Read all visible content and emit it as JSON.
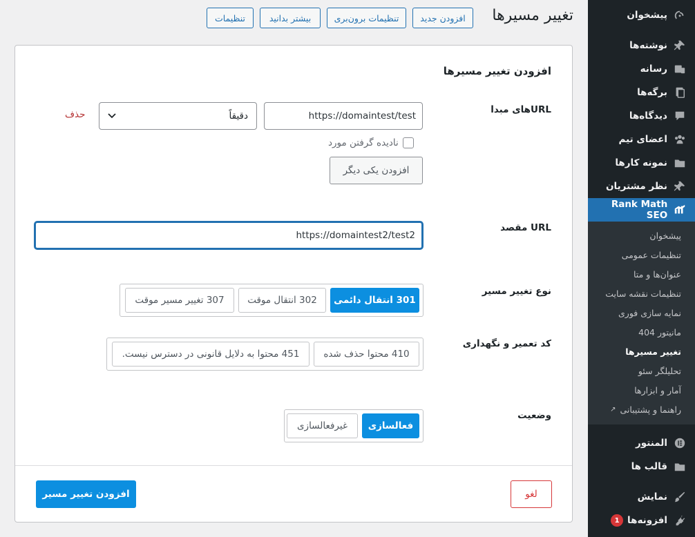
{
  "sidebar": {
    "items_top": [
      {
        "label": "پیشخوان",
        "icon": "dashboard-icon"
      },
      {
        "label": "نوشته‌ها",
        "icon": "pin-icon"
      },
      {
        "label": "رسانه",
        "icon": "media-icon"
      },
      {
        "label": "برگه‌ها",
        "icon": "pages-icon"
      },
      {
        "label": "دیدگاه‌ها",
        "icon": "comments-icon"
      },
      {
        "label": "اعضای تیم",
        "icon": "team-icon"
      },
      {
        "label": "نمونه کارها",
        "icon": "folder-icon"
      },
      {
        "label": "نظر مشتریان",
        "icon": "pin-icon"
      }
    ],
    "current": {
      "label": "Rank Math SEO",
      "icon": "rank-math-icon"
    },
    "submenu": [
      {
        "label": "پیشخوان"
      },
      {
        "label": "تنظیمات عمومی"
      },
      {
        "label": "عنوان‌ها و متا"
      },
      {
        "label": "تنظیمات نقشه سایت"
      },
      {
        "label": "نمایه سازی فوری"
      },
      {
        "label": "مانیتور 404"
      },
      {
        "label": "تغییر مسیرها"
      },
      {
        "label": "تحلیلگر سئو"
      },
      {
        "label": "آمار و ابزارها"
      },
      {
        "label": "راهنما و پشتیبانی"
      }
    ],
    "items_bottom": [
      {
        "label": "المنتور",
        "icon": "elementor-icon"
      },
      {
        "label": "قالب ها",
        "icon": "folder-icon"
      },
      {
        "label": "نمایش",
        "icon": "brush-icon"
      },
      {
        "label": "افزونه‌ها",
        "icon": "plugin-icon",
        "badge": "1"
      }
    ]
  },
  "header": {
    "title": "تغییر مسیرها",
    "buttons": {
      "add_new": "افزودن جدید",
      "import_export": "تنظیمات برون‌بری",
      "learn_more": "بیشتر بدانید",
      "settings": "تنظیمات"
    }
  },
  "form": {
    "title": "افزودن تغییر مسیرها",
    "source": {
      "label": "URLهای مبدا",
      "value": "https://domaintest/test",
      "match_type": "دقیقاً",
      "delete_label": "حذف",
      "ignore_case_label": "نادیده گرفتن مورد",
      "add_another_label": "افزودن یکی دیگر"
    },
    "destination": {
      "label": "URL مقصد",
      "value": "https://domaintest2/test2"
    },
    "redirect_type": {
      "label": "نوع تغییر مسیر",
      "options": [
        "301 انتقال دائمی",
        "302 انتقال موقت",
        "307 تغییر مسیر موقت"
      ],
      "selected": "301 انتقال دائمی"
    },
    "maintenance_code": {
      "label": "کد تعمیر و نگهداری",
      "options": [
        "410 محتوا حذف شده",
        "451 محتوا به دلایل قانونی در دسترس نیست."
      ]
    },
    "status": {
      "label": "وضعیت",
      "options": [
        "فعالسازی",
        "غیرفعالسازی"
      ],
      "selected": "فعالسازی"
    },
    "submit_label": "افزودن تغییر مسیر",
    "cancel_label": "لغو"
  },
  "colors": {
    "sidebar_bg": "#1d2327",
    "accent": "#2271b1",
    "active_button": "#0c8fe0",
    "danger": "#d63638"
  }
}
